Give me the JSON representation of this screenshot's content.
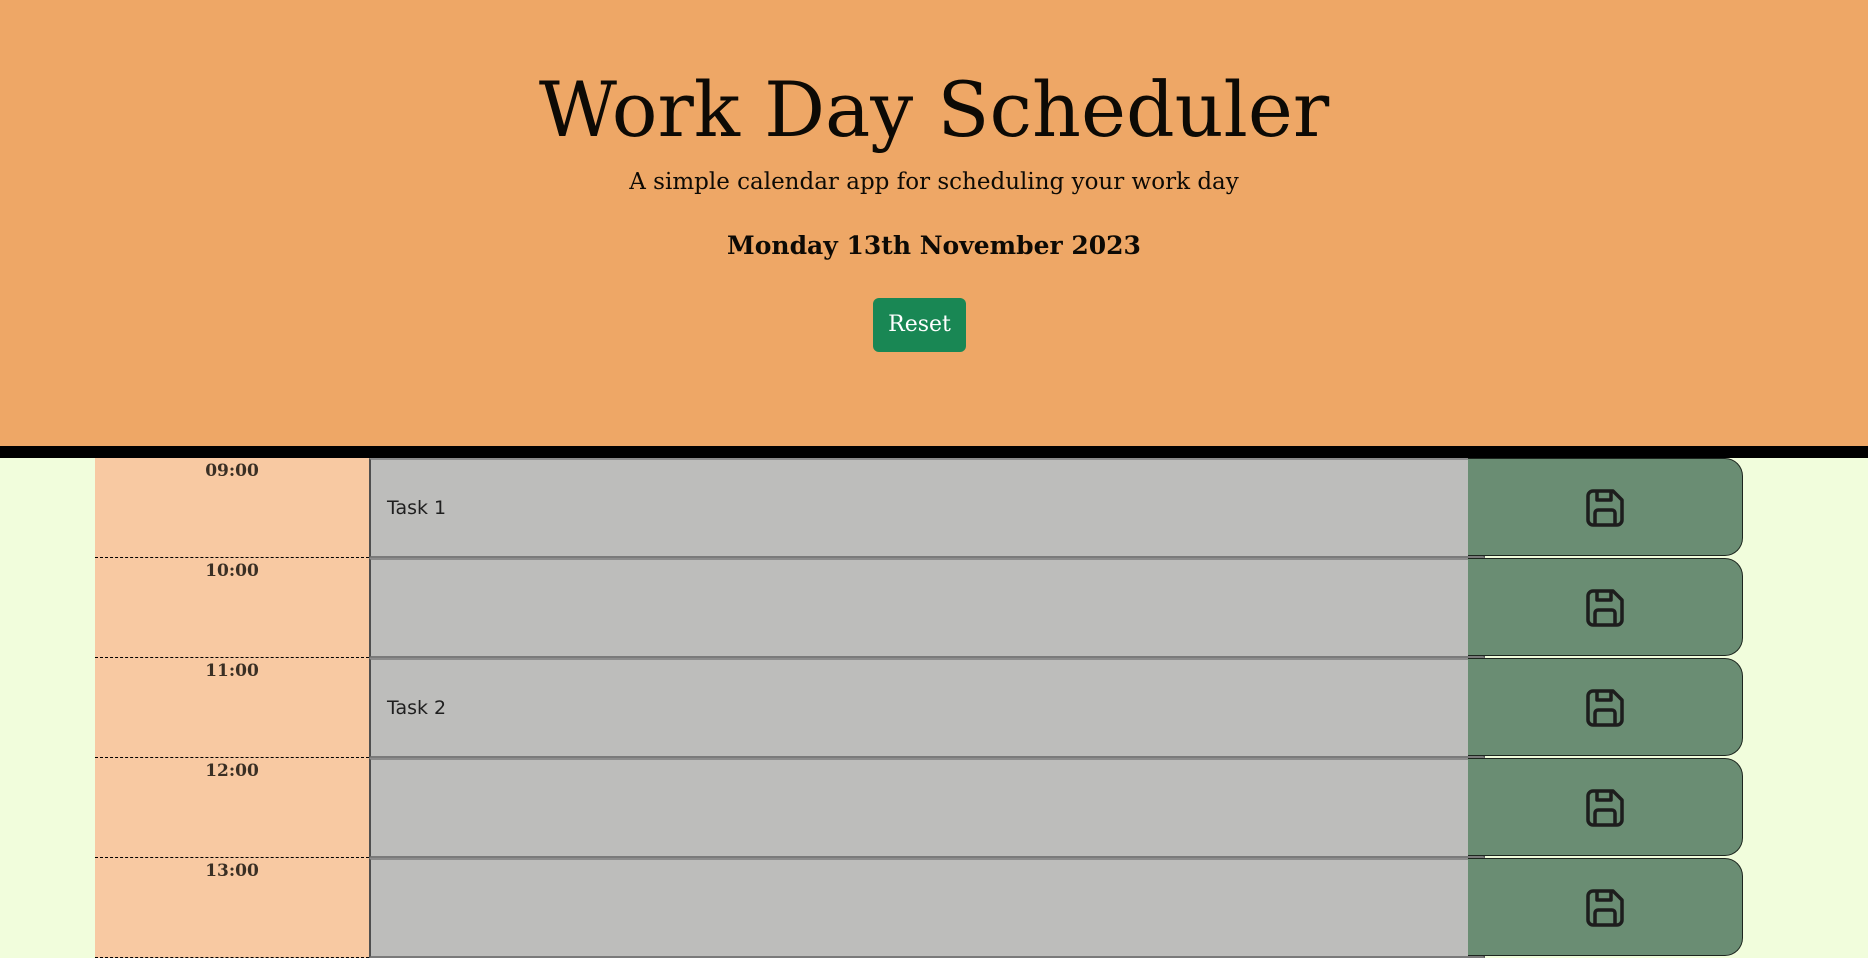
{
  "header": {
    "title": "Work Day Scheduler",
    "subtitle": "A simple calendar app for scheduling your work day",
    "date": "Monday 13th November 2023",
    "reset_label": "Reset"
  },
  "colors": {
    "header_bg": "#eea766",
    "page_bg": "#f1fddc",
    "hour_bg": "#f8c9a2",
    "task_bg": "#bdbdbb",
    "save_bg": "#6a8d73",
    "reset_bg": "#198754"
  },
  "icons": {
    "save": "floppy-disk-icon"
  },
  "schedule": [
    {
      "hour": "09:00",
      "task": "Task 1"
    },
    {
      "hour": "10:00",
      "task": ""
    },
    {
      "hour": "11:00",
      "task": "Task 2"
    },
    {
      "hour": "12:00",
      "task": ""
    },
    {
      "hour": "13:00",
      "task": ""
    }
  ]
}
